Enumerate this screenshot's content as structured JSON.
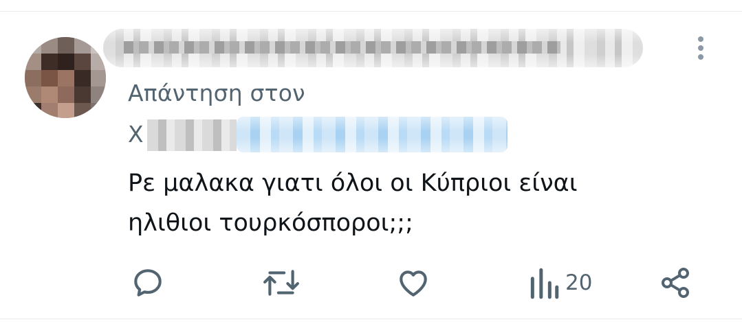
{
  "tweet": {
    "reply_to_label": "Απάντηση στον",
    "reply_to_handle_initial": "X",
    "text_lines": [
      "Ρε μαλακα γιατι όλοι οι Κύπριοι είναι",
      "ηλιθιοι τουρκόσποροι;;;"
    ]
  },
  "actions": {
    "reply_icon": "reply-bubble-icon",
    "retweet_icon": "retweet-icon",
    "like_icon": "heart-icon",
    "views_icon": "bar-chart-icon",
    "views_count": "20",
    "share_icon": "share-icon"
  },
  "colors": {
    "text_primary": "#0f1419",
    "text_secondary": "#536471",
    "icon_grey": "#536471",
    "divider": "#e9ecef"
  },
  "redactions": {
    "author_name_and_handle": "blurred",
    "reply_to_handle": "blurred",
    "avatar": "pixelated"
  }
}
